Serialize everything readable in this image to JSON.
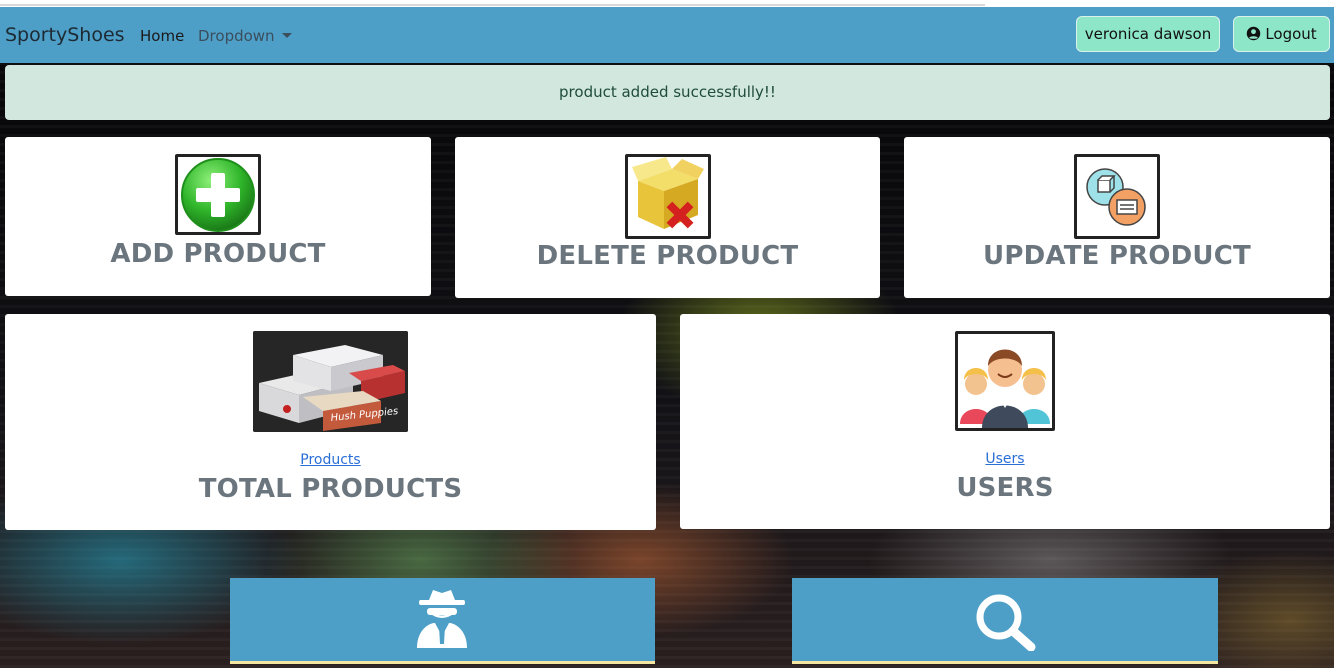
{
  "navbar": {
    "brand": "SportyShoes",
    "home": "Home",
    "dropdown": "Dropdown",
    "user": "veronica dawson",
    "logout": "Logout"
  },
  "alert": {
    "message": "product added successfully!!"
  },
  "cards": {
    "add": {
      "title": "ADD PRODUCT",
      "icon": "add-plus-icon"
    },
    "delete": {
      "title": "DELETE PRODUCT",
      "icon": "box-delete-icon"
    },
    "update": {
      "title": "UPDATE PRODUCT",
      "icon": "update-exchange-icon"
    },
    "total": {
      "title": "TOTAL PRODUCTS",
      "link": "Products",
      "image": "shoe-boxes-image"
    },
    "users": {
      "title": "USERS",
      "link": "Users",
      "image": "users-group-icon"
    }
  },
  "tiles": {
    "left": {
      "icon": "spy-icon"
    },
    "right": {
      "icon": "search-icon"
    }
  },
  "colors": {
    "navbar": "#4e9fc8",
    "button": "#8ee6c8",
    "alert_bg": "#d2e7de",
    "title_gray": "#6b757d",
    "link": "#2a6fd6"
  }
}
